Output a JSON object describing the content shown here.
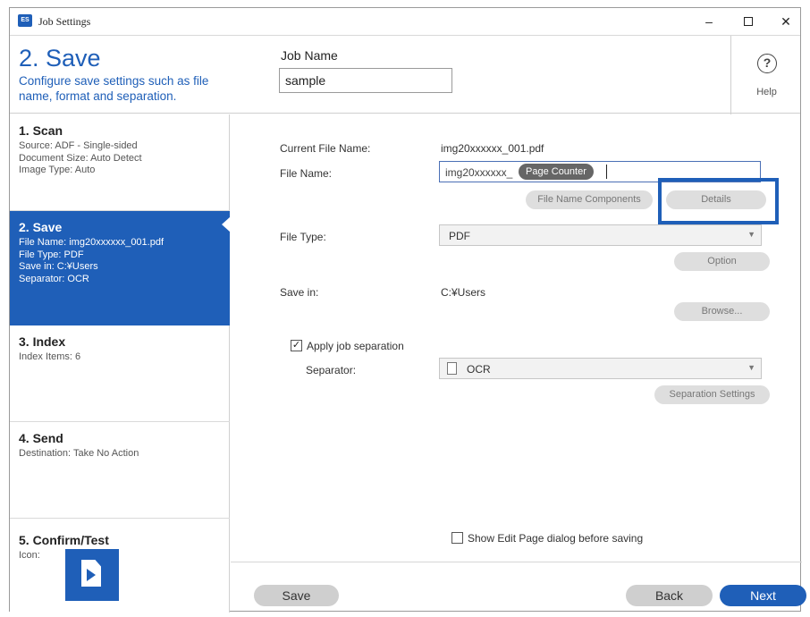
{
  "window": {
    "title": "Job Settings",
    "app_icon_label": "ES",
    "minimize_glyph": "–",
    "close_glyph": "✕"
  },
  "header": {
    "step_title": "2. Save",
    "step_description": "Configure save settings such as file name, format and separation.",
    "job_name_label": "Job Name",
    "job_name_value": "sample",
    "help_glyph": "?",
    "help_label": "Help"
  },
  "sidebar": {
    "scan": {
      "title": "1. Scan",
      "lines": [
        "Source: ADF - Single-sided",
        "Document Size: Auto Detect",
        "Image Type: Auto"
      ]
    },
    "save": {
      "title": "2. Save",
      "lines": [
        "File Name: img20xxxxxx_001.pdf",
        "File Type: PDF",
        "Save in: C:¥Users",
        "Separator: OCR"
      ]
    },
    "index": {
      "title": "3. Index",
      "lines": [
        "Index Items: 6"
      ]
    },
    "send": {
      "title": "4. Send",
      "lines": [
        "Destination: Take No Action"
      ]
    },
    "confirm": {
      "title": "5. Confirm/Test",
      "icon_label": "Icon:",
      "icon": "document-arrow-icon"
    }
  },
  "main": {
    "current_file_name_label": "Current File Name:",
    "current_file_name_value": "img20xxxxxx_001.pdf",
    "file_name_label": "File Name:",
    "file_name_prefix": "img20xxxxxx_",
    "file_name_token": "Page Counter",
    "file_name_components_button": "File Name Components",
    "details_button": "Details",
    "file_type_label": "File Type:",
    "file_type_value": "PDF",
    "option_button": "Option",
    "save_in_label": "Save in:",
    "save_in_value": "C:¥Users",
    "browse_button": "Browse...",
    "apply_separation_label": "Apply job separation",
    "apply_separation_checked": true,
    "separator_label": "Separator:",
    "separator_value": "OCR",
    "separation_settings_button": "Separation Settings",
    "show_edit_page_label": "Show Edit Page dialog before saving",
    "show_edit_page_checked": false
  },
  "footer": {
    "save_button": "Save",
    "back_button": "Back",
    "next_button": "Next"
  },
  "colors": {
    "accent": "#1f5fb8",
    "highlight_border": "#1f5fb8",
    "button_grey": "#dedede"
  }
}
